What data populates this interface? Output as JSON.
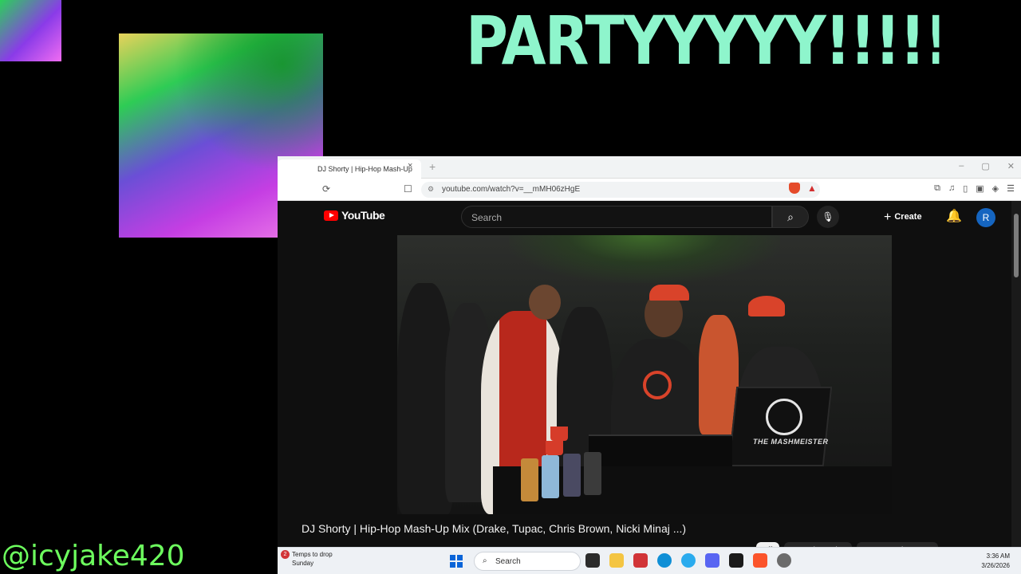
{
  "overlay": {
    "title": "PARTYYYYY!!!!!!",
    "handle": "@icyjake420"
  },
  "browser": {
    "tab_title": "DJ Shorty | Hip-Hop Mash-Up",
    "tab_close": "×",
    "new_tab": "+",
    "url": "youtube.com/watch?v=__mMH06zHgE",
    "window_controls": [
      "–",
      "▢",
      "✕"
    ]
  },
  "youtube": {
    "logo_text": "YouTube",
    "search_placeholder": "Search",
    "create_label": "Create",
    "avatar_letter": "R",
    "video_title": "DJ Shorty | Hip-Hop Mash-Up Mix (Drake, Tupac, Chris Brown, Nicki Minaj ...)",
    "laptop_text": "THE MASHMEISTER",
    "chips": [
      "All",
      "From the series",
      "From DJ Shorty SA"
    ]
  },
  "taskbar": {
    "weather_line1": "Temps to drop",
    "weather_line2": "Sunday",
    "notification_count": "2",
    "search_label": "Search",
    "time": "3:36 AM",
    "date": "3/26/2026"
  },
  "colors": {
    "title_mint": "#8ef5cc",
    "handle_green": "#6dff5e",
    "youtube_red": "#ff0000",
    "yt_bg": "#0f0f0f"
  }
}
